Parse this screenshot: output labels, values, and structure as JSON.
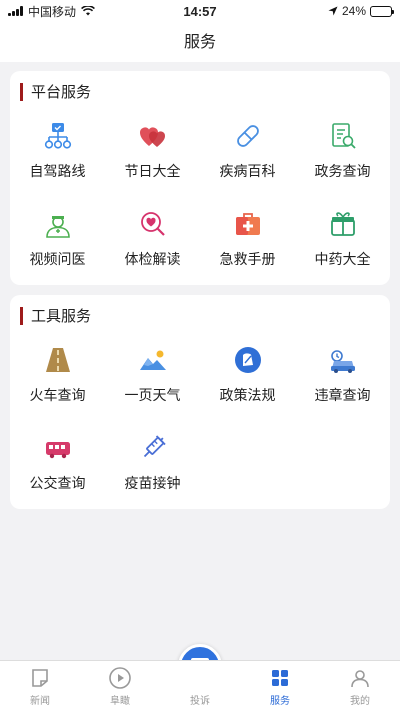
{
  "status_bar": {
    "carrier": "中国移动",
    "time": "14:57",
    "battery_percent": "24%",
    "battery_level": 0.24
  },
  "header": {
    "title": "服务"
  },
  "platform_section": {
    "title": "平台服务",
    "items": [
      {
        "label": "自驾路线",
        "icon": "route-icon"
      },
      {
        "label": "节日大全",
        "icon": "hearts-icon"
      },
      {
        "label": "疾病百科",
        "icon": "pill-icon"
      },
      {
        "label": "政务查询",
        "icon": "document-search-icon"
      },
      {
        "label": "视频问医",
        "icon": "doctor-icon"
      },
      {
        "label": "体检解读",
        "icon": "heart-search-icon"
      },
      {
        "label": "急救手册",
        "icon": "first-aid-kit-icon"
      },
      {
        "label": "中药大全",
        "icon": "herb-box-icon"
      }
    ]
  },
  "tools_section": {
    "title": "工具服务",
    "items": [
      {
        "label": "火车查询",
        "icon": "railway-icon"
      },
      {
        "label": "一页天气",
        "icon": "weather-landscape-icon"
      },
      {
        "label": "政策法规",
        "icon": "policy-book-icon"
      },
      {
        "label": "违章查询",
        "icon": "traffic-violation-icon"
      },
      {
        "label": "公交查询",
        "icon": "bus-icon"
      },
      {
        "label": "疫苗接钟",
        "icon": "vaccine-icon"
      }
    ]
  },
  "tabbar": {
    "tabs": [
      {
        "label": "新闻",
        "icon": "news-icon"
      },
      {
        "label": "阜瞰",
        "icon": "play-icon"
      },
      {
        "label": "投诉",
        "icon": "chat-icon"
      },
      {
        "label": "服务",
        "icon": "service-icon"
      },
      {
        "label": "我的",
        "icon": "profile-icon"
      }
    ],
    "active": "服务"
  },
  "colors": {
    "accent": "#2c6bd6",
    "section_bar": "#9e1b1b",
    "background": "#f2f2f4"
  }
}
